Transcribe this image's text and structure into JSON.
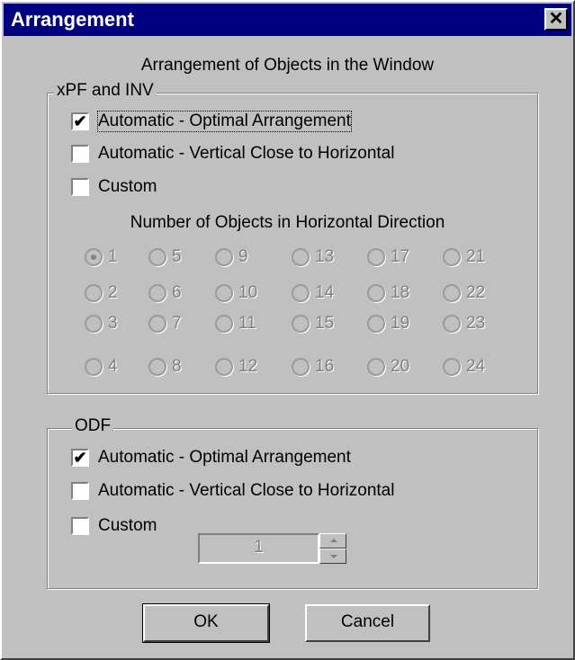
{
  "window": {
    "title": "Arrangement",
    "close_label": "✕"
  },
  "heading": "Arrangement  of Objects in the Window",
  "xpf_group": {
    "legend": "xPF and INV",
    "options": [
      {
        "label": "Automatic  - Optimal Arrangement",
        "checked": true
      },
      {
        "label": "Automatic -  Vertical Close to Horizontal",
        "checked": false
      },
      {
        "label": "Custom",
        "checked": false
      }
    ],
    "number_label": "Number of Objects in Horizontal Direction",
    "radio_rows": [
      [
        "1",
        "5",
        "9",
        "13",
        "17",
        "21"
      ],
      [
        "2",
        "6",
        "10",
        "14",
        "18",
        "22"
      ],
      [
        "3",
        "7",
        "11",
        "15",
        "19",
        "23"
      ],
      [
        "4",
        "8",
        "12",
        "16",
        "20",
        "24"
      ]
    ],
    "selected": "1"
  },
  "odf_group": {
    "legend": "ODF",
    "options": [
      {
        "label": "Automatic - Optimal Arrangement",
        "checked": true
      },
      {
        "label": "Automatic - Vertical Close to Horizontal",
        "checked": false
      },
      {
        "label": "Custom",
        "checked": false
      }
    ],
    "spin_value": "1"
  },
  "buttons": {
    "ok": "OK",
    "cancel": "Cancel"
  },
  "colors": {
    "title_bar": "#000080",
    "face": "#c0c0c0",
    "disabled_text": "#808080"
  }
}
